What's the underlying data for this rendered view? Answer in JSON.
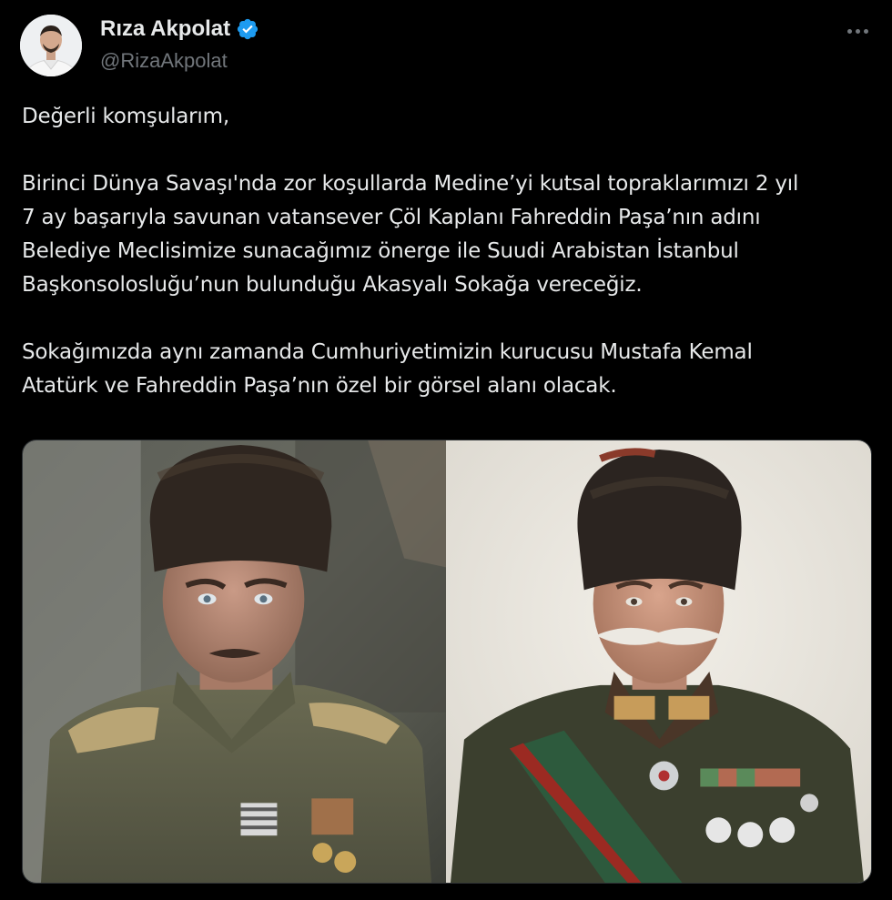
{
  "author": {
    "display_name": "Rıza Akpolat",
    "handle": "@RizaAkpolat",
    "verified": true,
    "verified_color": "#1d9bf0"
  },
  "tweet": {
    "lines_p1": [
      "Değerli komşularım,"
    ],
    "lines_p2": [
      "Birinci Dünya Savaşı'nda zor koşullarda Medine’yi kutsal topraklarımızı 2 yıl",
      "7 ay başarıyla savunan vatansever Çöl Kaplanı Fahreddin Paşa’nın adını",
      "Belediye Meclisimize sunacağımız önerge ile Suudi Arabistan İstanbul",
      "Başkonsolosluğu’nun bulunduğu Akasyalı Sokağa vereceğiz."
    ],
    "lines_p3": [
      "Sokağımızda aynı zamanda Cumhuriyetimizin kurucusu Mustafa Kemal",
      "Atatürk ve Fahreddin Paşa’nın özel bir görsel alanı olacak."
    ]
  },
  "media": {
    "left_icon": "portrait-photo-icon",
    "right_icon": "portrait-photo-icon"
  },
  "icons": {
    "more": "more-horizontal-icon",
    "verified": "verified-badge-icon"
  }
}
